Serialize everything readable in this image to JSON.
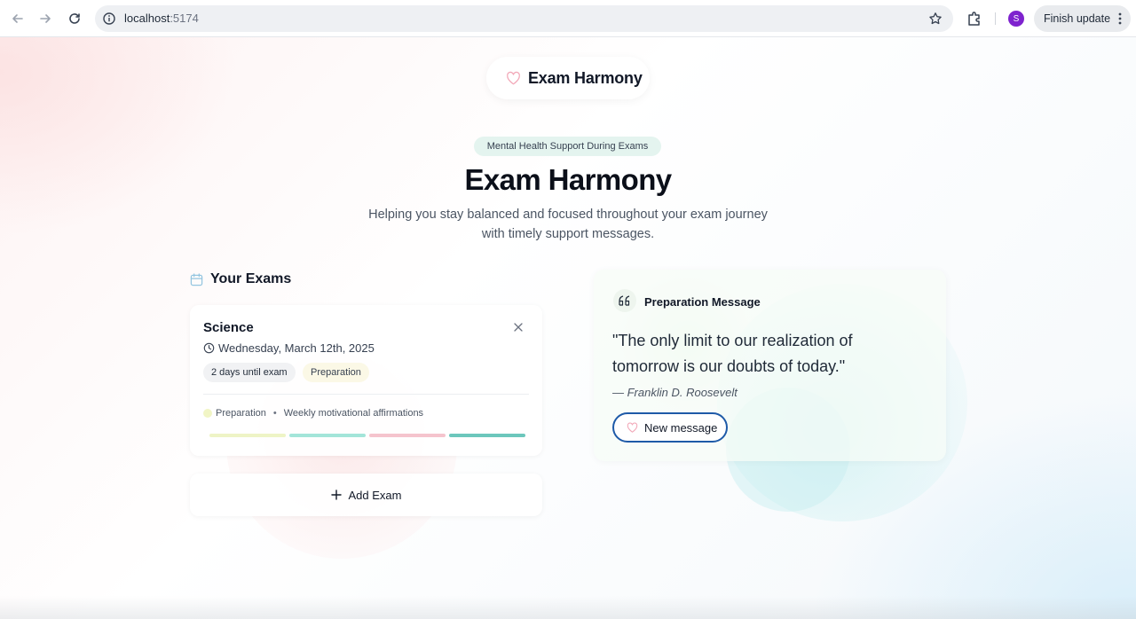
{
  "browser": {
    "url_host": "localhost",
    "url_port": ":5174",
    "profile_initial": "S",
    "update_label": "Finish update"
  },
  "brand": {
    "name": "Exam Harmony"
  },
  "hero": {
    "tagline": "Mental Health Support During Exams",
    "title": "Exam Harmony",
    "subtitle_line1": "Helping you stay balanced and focused throughout your exam journey",
    "subtitle_line2": "with timely support messages."
  },
  "exams": {
    "section_title": "Your Exams",
    "items": [
      {
        "subject": "Science",
        "date": "Wednesday, March 12th, 2025",
        "days_until": "2 days until exam",
        "phase": "Preparation",
        "phase_label": "Preparation",
        "phase_description": "Weekly motivational affirmations"
      }
    ],
    "add_label": "Add Exam"
  },
  "phase_bar_colors": [
    "#eef4c6",
    "#a3e5d9",
    "#f5c4cd",
    "#6cc7bc"
  ],
  "message": {
    "title": "Preparation Message",
    "quote_line1": "\"The only limit to our realization of",
    "quote_line2": "tomorrow is our doubts of today.\"",
    "author": "— Franklin D. Roosevelt",
    "button_label": "New message"
  },
  "colors": {
    "accent_heart": "#f2a8b8",
    "button_border": "#1e5aa8",
    "calendar_icon": "#93c5e0"
  }
}
